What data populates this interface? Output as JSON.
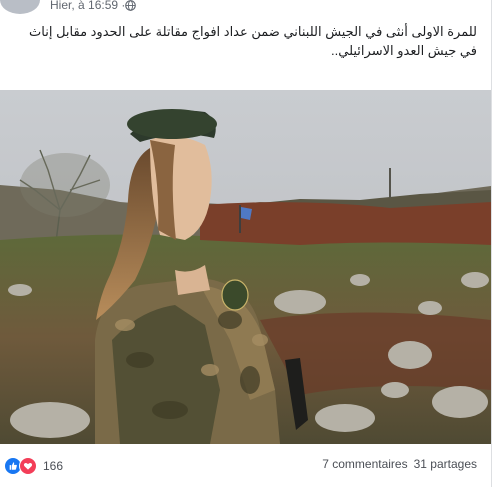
{
  "post": {
    "timestamp": "Hier, à 16:59 ·",
    "privacy_icon": "globe-icon",
    "text": "للمرة الاولى أنثى في الجيش اللبناني ضمن عداد افواج مقاتلة على الحدود مقابل إناث في جيش العدو الاسرائيلي..",
    "photo_icon": "soldier-photo"
  },
  "footer": {
    "reaction_icons": [
      "like-icon",
      "love-icon"
    ],
    "reaction_count": "166",
    "comments": "7 commentaires",
    "shares": "31 partages"
  },
  "colors": {
    "like_blue": "#1877f2",
    "love_red": "#f33e58",
    "meta_text": "#616770",
    "stats_text": "#4b4f56"
  }
}
